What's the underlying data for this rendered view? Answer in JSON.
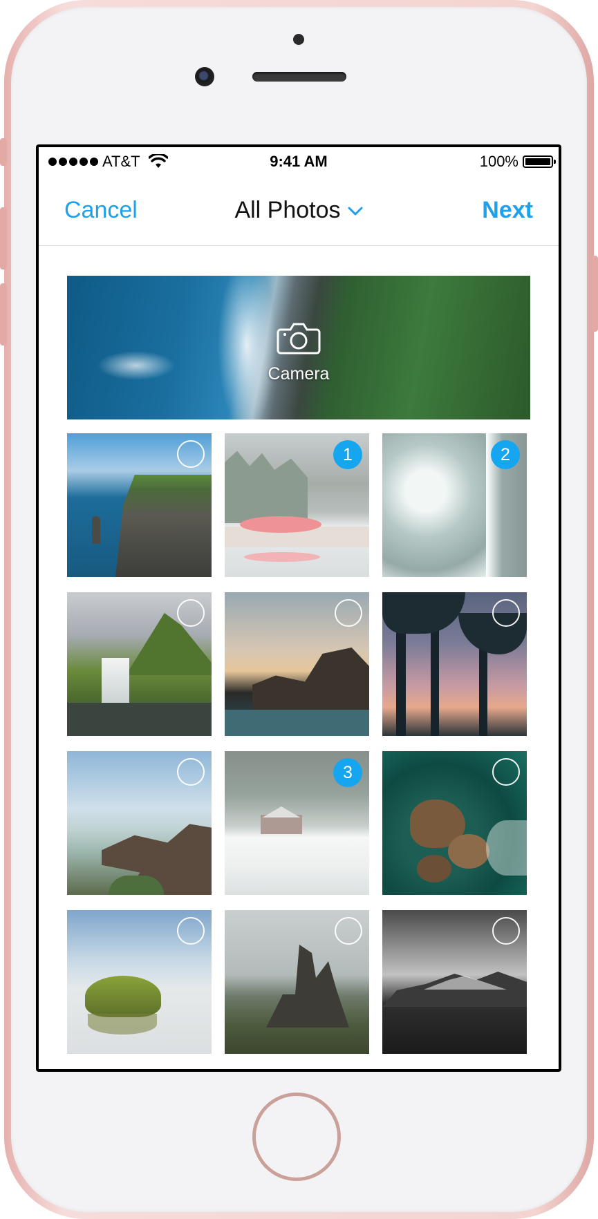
{
  "status_bar": {
    "carrier": "AT&T",
    "time": "9:41 AM",
    "battery": "100%"
  },
  "nav": {
    "cancel_label": "Cancel",
    "title": "All Photos",
    "next_label": "Next"
  },
  "camera_tile": {
    "label": "Camera"
  },
  "photos": [
    {
      "subject": "sea cliffs",
      "selected": false,
      "order": ""
    },
    {
      "subject": "red boat on lake",
      "selected": true,
      "order": "1"
    },
    {
      "subject": "waves aerial",
      "selected": true,
      "order": "2"
    },
    {
      "subject": "waterfall mountain",
      "selected": false,
      "order": ""
    },
    {
      "subject": "rocky coast sunset",
      "selected": false,
      "order": ""
    },
    {
      "subject": "palm trees dusk",
      "selected": false,
      "order": ""
    },
    {
      "subject": "rocky shoreline",
      "selected": false,
      "order": ""
    },
    {
      "subject": "cabin in snow",
      "selected": true,
      "order": "3"
    },
    {
      "subject": "rocks in green sea",
      "selected": false,
      "order": ""
    },
    {
      "subject": "mossy rock in water",
      "selected": false,
      "order": ""
    },
    {
      "subject": "rock pinnacles highlands",
      "selected": false,
      "order": ""
    },
    {
      "subject": "snowy mountains monochrome",
      "selected": false,
      "order": ""
    }
  ],
  "colors": {
    "accent": "#1ea0ea",
    "badge": "#16a6ef",
    "phone_rose": "#f3d4d1"
  }
}
